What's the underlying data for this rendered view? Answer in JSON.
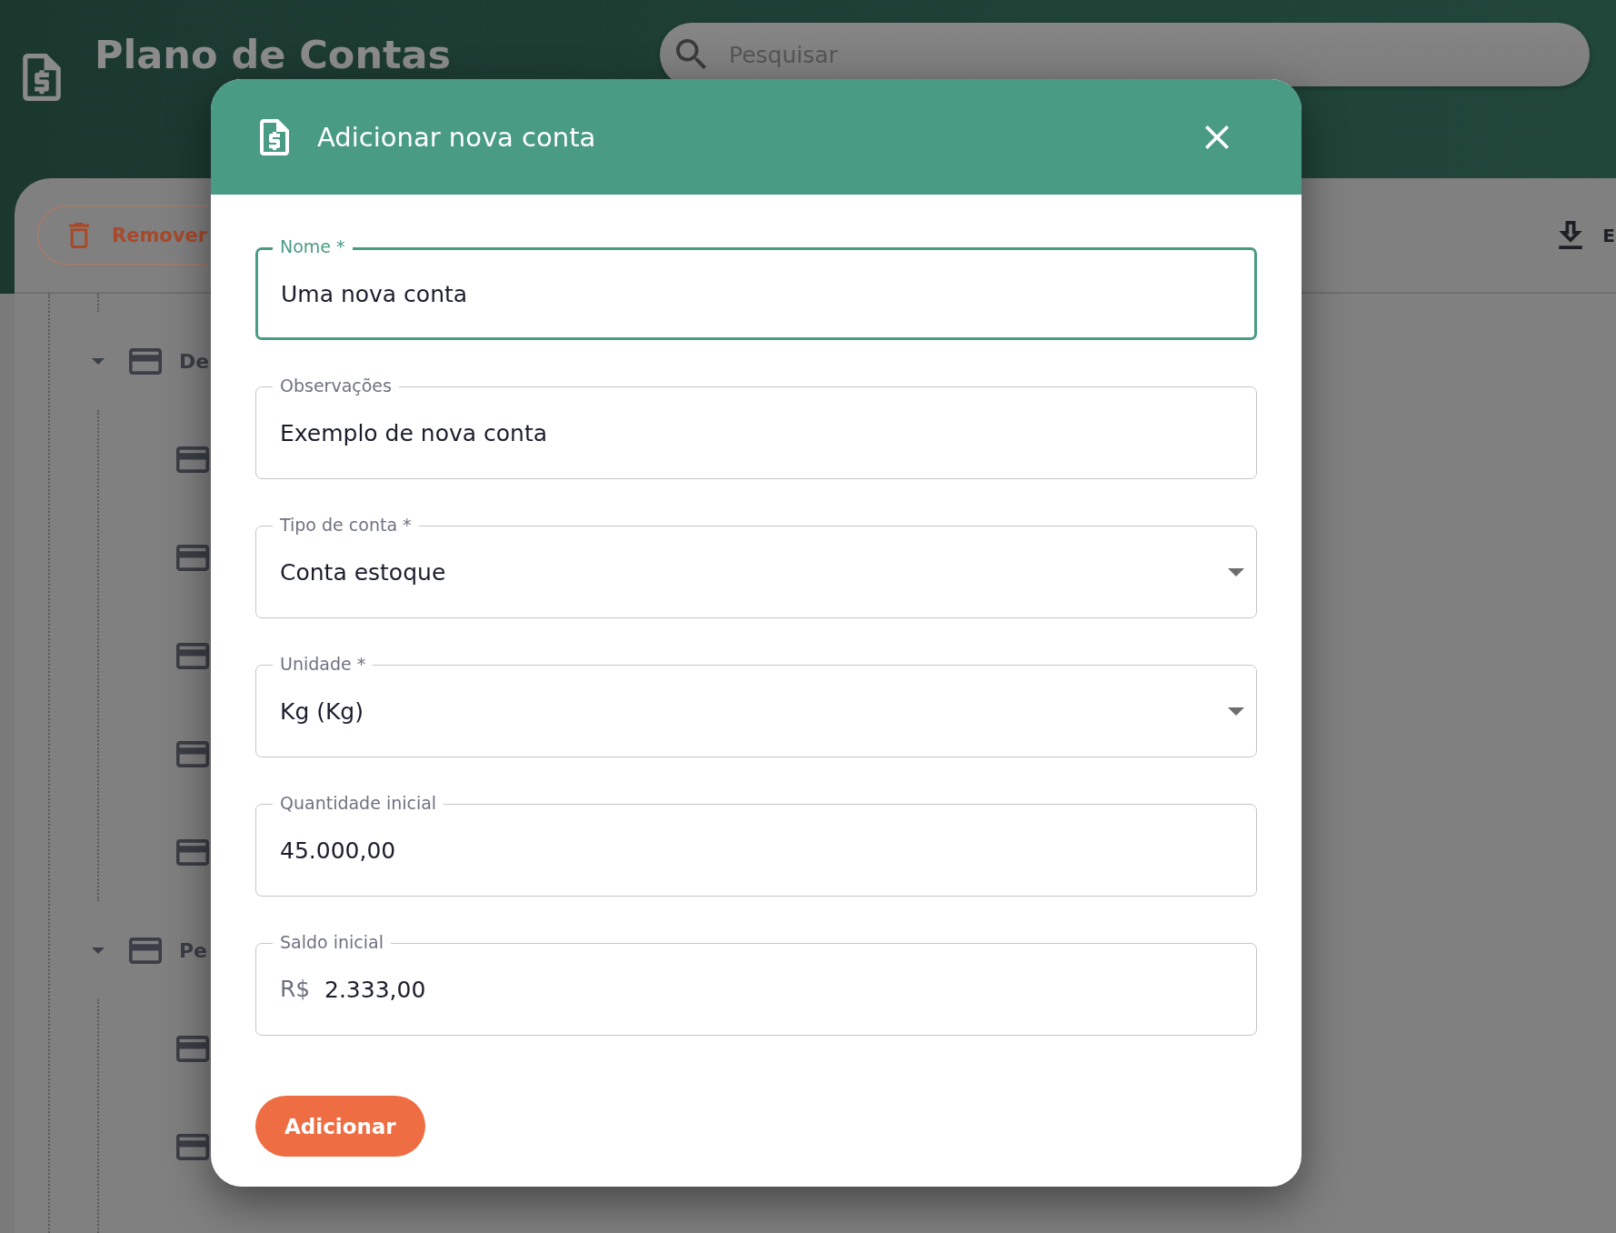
{
  "header": {
    "title": "Plano de Contas",
    "search": {
      "placeholder": "Pesquisar"
    }
  },
  "toolbar": [
    {
      "kind": "remove",
      "label": "Remover"
    },
    {
      "kind": "download",
      "label": "E"
    }
  ],
  "tree": [
    {
      "kind": "account",
      "label": "De",
      "expanded": true,
      "children": [
        {
          "kind": "account"
        },
        {
          "kind": "account"
        },
        {
          "kind": "account"
        },
        {
          "kind": "account"
        },
        {
          "kind": "account"
        }
      ]
    },
    {
      "kind": "account",
      "label": "Pe",
      "expanded": true,
      "children": [
        {
          "kind": "account"
        },
        {
          "kind": "account"
        }
      ]
    }
  ],
  "dialog": {
    "title": "Adicionar nova conta",
    "fields": [
      {
        "kind": "text",
        "label": "Nome *",
        "value": "Uma nova conta",
        "focused": true
      },
      {
        "kind": "text",
        "label": "Observações",
        "value": "Exemplo de nova conta",
        "focused": false
      },
      {
        "kind": "select",
        "label": "Tipo de conta *",
        "value": "Conta estoque",
        "focused": false
      },
      {
        "kind": "select",
        "label": "Unidade *",
        "value": "Kg (Kg)",
        "focused": false
      },
      {
        "kind": "text",
        "label": "Quantidade inicial",
        "value": "45.000,00",
        "focused": false
      },
      {
        "kind": "text",
        "label": "Saldo inicial",
        "prefix": "R$",
        "value": "2.333,00",
        "focused": false
      }
    ],
    "submit": "Adicionar"
  }
}
